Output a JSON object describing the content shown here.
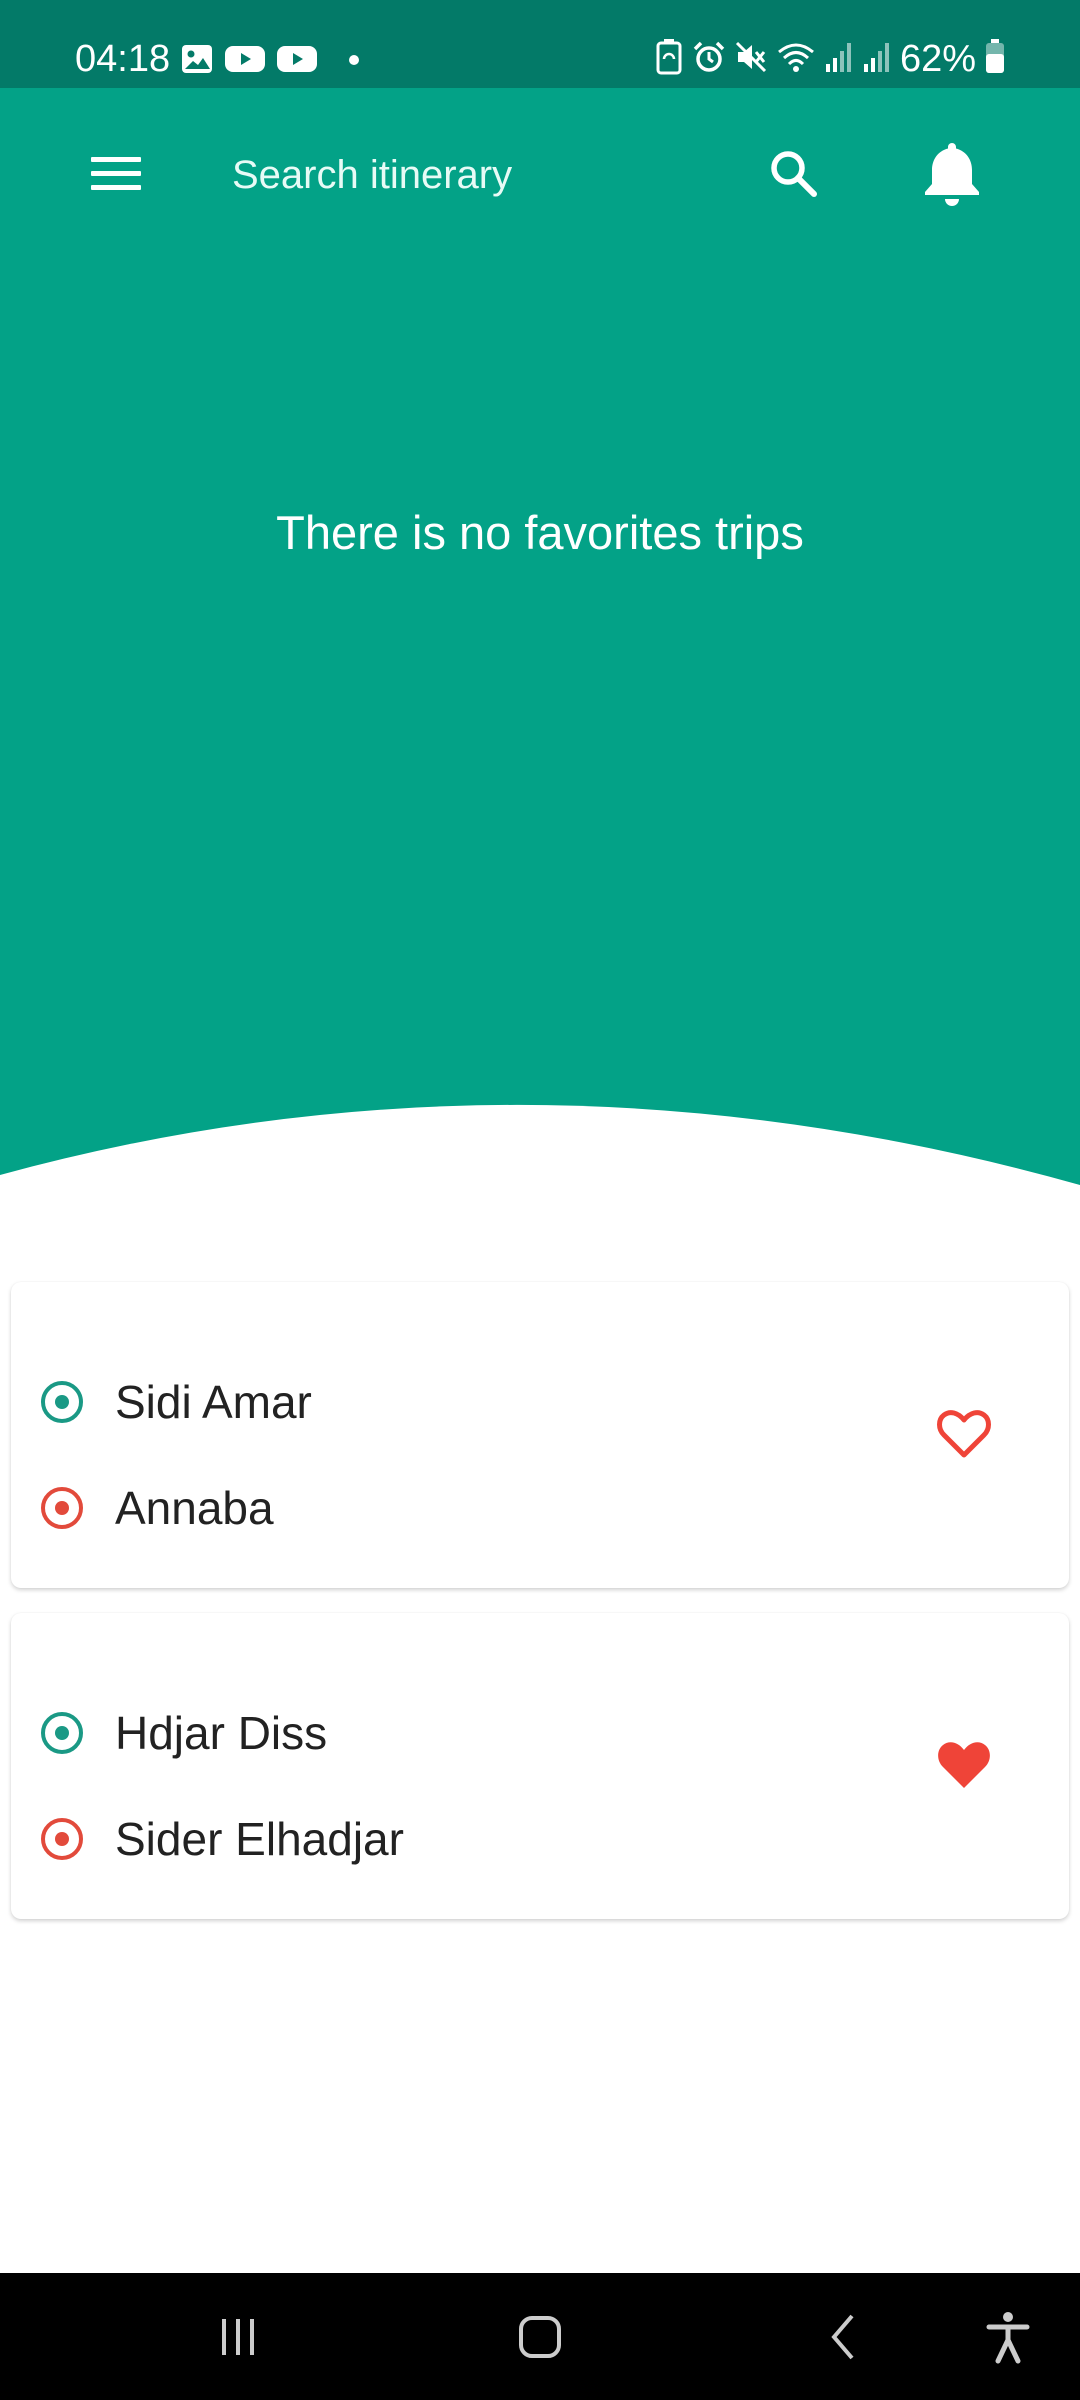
{
  "status_bar": {
    "time": "04:18",
    "left_icons": [
      "gallery-icon",
      "youtube-icon",
      "youtube-icon",
      "dot-icon"
    ],
    "right_icons": [
      "battery-saver-icon",
      "alarm-icon",
      "mute-icon",
      "wifi-icon",
      "signal-icon",
      "signal-icon"
    ],
    "battery_text": "62%",
    "battery_level": 62
  },
  "app_bar": {
    "menu_icon": "menu-icon",
    "search_placeholder": "Search itinerary",
    "search_icon": "search-icon",
    "notifications_icon": "bell-icon"
  },
  "hero": {
    "message": "There is no favorites trips"
  },
  "trips": [
    {
      "from": "Sidi Amar",
      "to": "Annaba",
      "favorite": false,
      "favorite_icon": "heart-outline-icon"
    },
    {
      "from": "Hdjar Diss",
      "to": "Sider Elhadjar",
      "favorite": true,
      "favorite_icon": "heart-filled-icon"
    }
  ],
  "nav_bar": {
    "recents_icon": "recents-icon",
    "home_icon": "home-icon",
    "back_icon": "back-icon",
    "accessibility_icon": "accessibility-icon"
  },
  "colors": {
    "primary": "#03a287",
    "status_bar": "#037a68",
    "origin": "#1a9985",
    "destination": "#e24a3b",
    "favorite": "#ef4438",
    "nav_bar": "#000000"
  }
}
